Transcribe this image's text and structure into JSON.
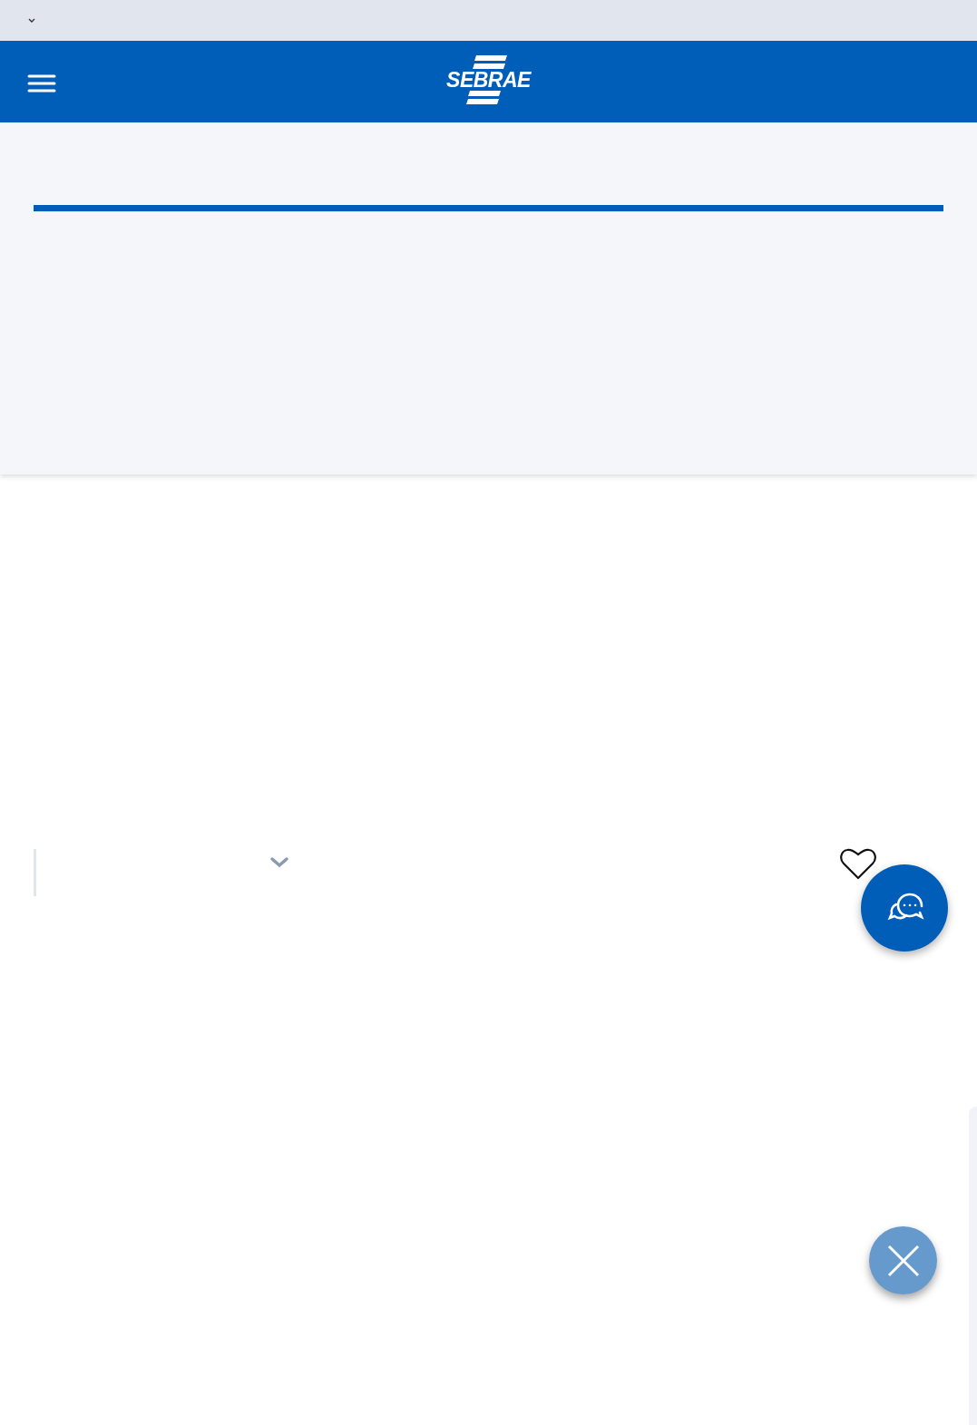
{
  "header": {
    "logo": "SEBRAE"
  }
}
